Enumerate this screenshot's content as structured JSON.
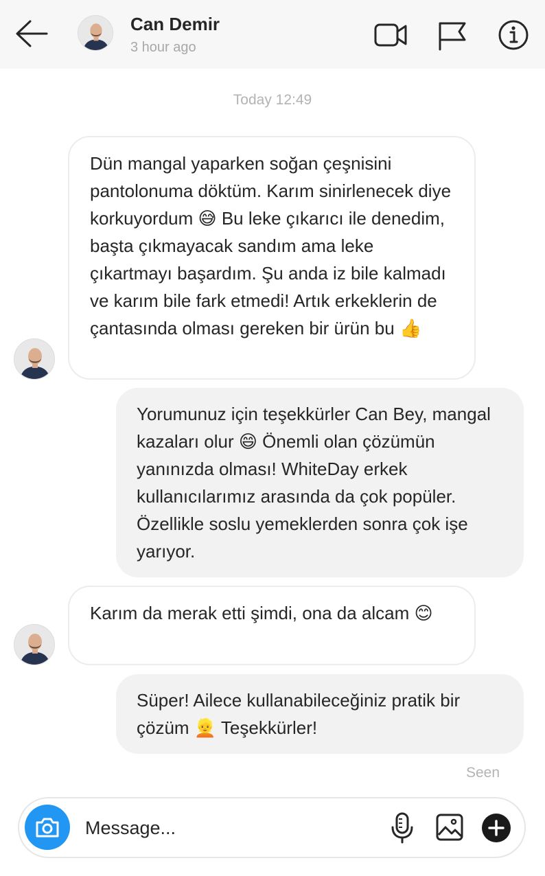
{
  "header": {
    "contact_name": "Can Demir",
    "contact_status": "3 hour ago",
    "icons": [
      "back-arrow-icon",
      "video-camera-icon",
      "flag-icon",
      "info-icon"
    ]
  },
  "thread": {
    "timestamp": "Today 12:49",
    "messages": [
      {
        "direction": "incoming",
        "text": "Dün mangal yaparken soğan çeşnisini pantolonuma döktüm. Karım sinirlenecek diye korkuyordum 😅 Bu leke çıkarıcı ile denedim, başta çıkmayacak sandım ama leke çıkartmayı başardım. Şu anda iz bile kalmadı ve karım bile fark etmedi! Artık erkeklerin de çantasında olması gereken bir ürün bu 👍"
      },
      {
        "direction": "outgoing",
        "text": "Yorumunuz için teşekkürler Can Bey, mangal kazaları olur 😄 Önemli olan çözümün yanınızda olması! WhiteDay erkek kullanıcılarımız arasında da çok popüler. Özellikle soslu yemeklerden sonra çok işe yarıyor."
      },
      {
        "direction": "incoming",
        "text": "Karım da merak etti şimdi, ona da alcam 😊"
      },
      {
        "direction": "outgoing",
        "text": "Süper! Ailece kullanabileceğiniz pratik bir çözüm 👱 Teşekkürler!"
      }
    ],
    "seen_label": "Seen"
  },
  "composer": {
    "placeholder": "Message...",
    "icons": [
      "camera-icon",
      "microphone-icon",
      "image-icon",
      "plus-icon"
    ],
    "camera_color": "#2196f3"
  }
}
